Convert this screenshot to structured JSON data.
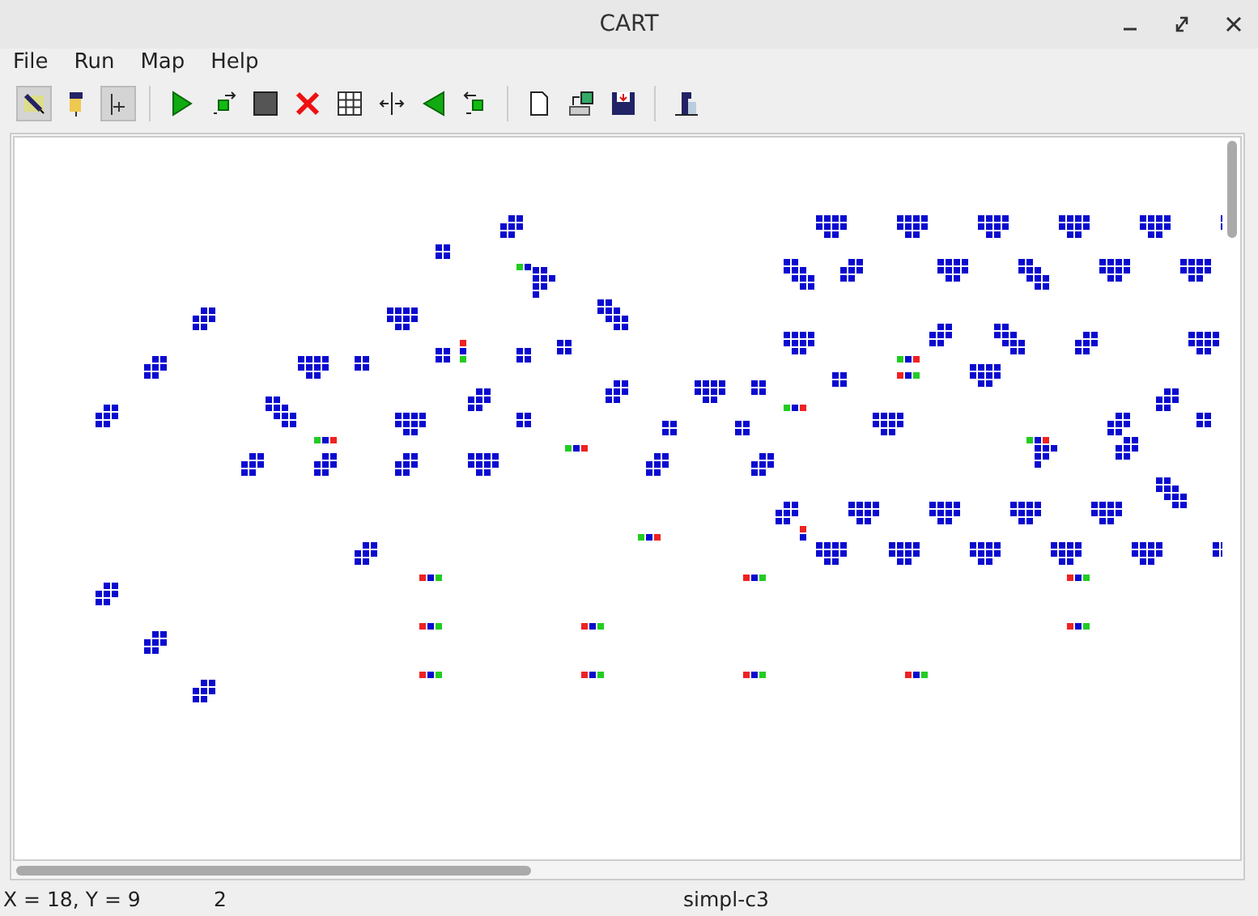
{
  "window": {
    "title": "CART"
  },
  "menu": [
    {
      "label": "File"
    },
    {
      "label": "Run"
    },
    {
      "label": "Map"
    },
    {
      "label": "Help"
    }
  ],
  "toolbar": [
    {
      "kind": "toggle",
      "on": true
    },
    {
      "kind": "toggle",
      "on": false
    },
    {
      "kind": "toggle",
      "on": true
    },
    {
      "kind": "separator"
    },
    {
      "kind": "button"
    },
    {
      "kind": "button"
    },
    {
      "kind": "button"
    },
    {
      "kind": "button"
    },
    {
      "kind": "button"
    },
    {
      "kind": "button"
    },
    {
      "kind": "button"
    },
    {
      "kind": "button"
    },
    {
      "kind": "separator"
    },
    {
      "kind": "button"
    },
    {
      "kind": "button"
    },
    {
      "kind": "button"
    },
    {
      "kind": "separator"
    },
    {
      "kind": "button"
    }
  ],
  "status_bar": {
    "position": "X = 18, Y = 9",
    "generation": "2",
    "rule": "simpl-c3"
  }
}
